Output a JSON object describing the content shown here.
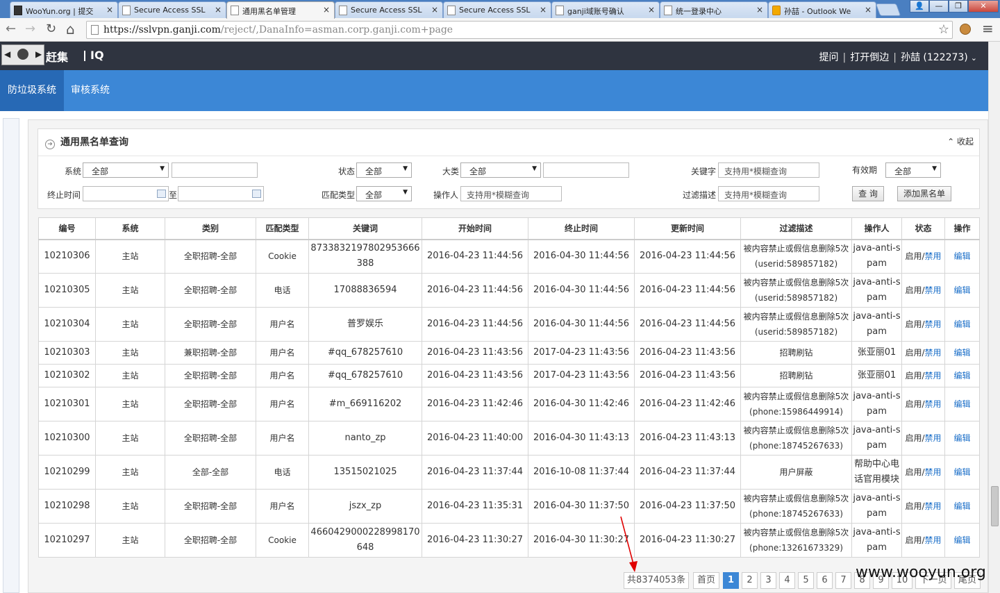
{
  "browser": {
    "tabs": [
      {
        "label": "WooYun.org | 提交",
        "icon": "wooyun-favicon"
      },
      {
        "label": "Secure Access SSL",
        "icon": "page-icon"
      },
      {
        "label": "通用黑名单管理",
        "icon": "page-icon",
        "active": true
      },
      {
        "label": "Secure Access SSL",
        "icon": "page-icon"
      },
      {
        "label": "Secure Access SSL",
        "icon": "page-icon"
      },
      {
        "label": "ganji域账号确认",
        "icon": "page-icon"
      },
      {
        "label": "统一登录中心",
        "icon": "page-icon"
      },
      {
        "label": "孙喆 - Outlook We",
        "icon": "outlook-icon"
      }
    ],
    "tab_close": "×",
    "window_buttons": [
      "👤",
      "—",
      "❐",
      "✕"
    ],
    "url_host": "https://sslvpn.ganji.com",
    "url_path": "/reject/,DanaInfo=asman.corp.ganji.com+page",
    "nav_icons": {
      "back": "←",
      "forward": "→",
      "reload": "↻",
      "home": "⌂",
      "star": "☆",
      "menu": "≡"
    }
  },
  "header": {
    "logo_arrows": [
      "◀",
      "▶"
    ],
    "brand": "赶集",
    "brand_suffix": "IQ",
    "links": [
      "提问",
      "打开倒边",
      "孙喆 (122273)"
    ],
    "caret": "⌄"
  },
  "subnav": [
    "防垃圾系统",
    "审核系统"
  ],
  "filter": {
    "title": "通用黑名单查询",
    "collapse": "收起",
    "fields": {
      "system_label": "系统",
      "system_value": "全部",
      "status_label": "状态",
      "status_value": "全部",
      "category_label": "大类",
      "category_value": "全部",
      "keyword_label": "关键字",
      "keyword_placeholder": "支持用*模糊查询",
      "validity_label": "有效期",
      "validity_value": "全部",
      "endtime_label": "终止时间",
      "to_label": "至",
      "matchtype_label": "匹配类型",
      "matchtype_value": "全部",
      "operator_label": "操作人",
      "operator_placeholder": "支持用*模糊查询",
      "desc_label": "过滤描述",
      "desc_placeholder": "支持用*模糊查询"
    },
    "query_button": "查 询",
    "add_button": "添加黑名单",
    "select_arrow": "▼"
  },
  "table": {
    "headers": [
      "编号",
      "系统",
      "类别",
      "匹配类型",
      "关键词",
      "开始时间",
      "终止时间",
      "更新时间",
      "过滤描述",
      "操作人",
      "状态",
      "操作"
    ],
    "status_on": "启用/",
    "status_ban": "禁用",
    "edit": "编辑",
    "rows": [
      [
        "10210306",
        "主站",
        "全职招聘-全部",
        "Cookie",
        "8733832197802953666388",
        "2016-04-23 11:44:56",
        "2016-04-30 11:44:56",
        "2016-04-23 11:44:56",
        "被内容禁止或假信息删除5次(userid:589857182)",
        "java-anti-spam"
      ],
      [
        "10210305",
        "主站",
        "全职招聘-全部",
        "电话",
        "17088836594",
        "2016-04-23 11:44:56",
        "2016-04-30 11:44:56",
        "2016-04-23 11:44:56",
        "被内容禁止或假信息删除5次(userid:589857182)",
        "java-anti-spam"
      ],
      [
        "10210304",
        "主站",
        "全职招聘-全部",
        "用户名",
        "普罗娱乐",
        "2016-04-23 11:44:56",
        "2016-04-30 11:44:56",
        "2016-04-23 11:44:56",
        "被内容禁止或假信息删除5次(userid:589857182)",
        "java-anti-spam"
      ],
      [
        "10210303",
        "主站",
        "兼职招聘-全部",
        "用户名",
        "#qq_678257610",
        "2016-04-23 11:43:56",
        "2017-04-23 11:43:56",
        "2016-04-23 11:43:56",
        "招聘刷钻",
        "张亚丽01"
      ],
      [
        "10210302",
        "主站",
        "全职招聘-全部",
        "用户名",
        "#qq_678257610",
        "2016-04-23 11:43:56",
        "2017-04-23 11:43:56",
        "2016-04-23 11:43:56",
        "招聘刷钻",
        "张亚丽01"
      ],
      [
        "10210301",
        "主站",
        "全职招聘-全部",
        "用户名",
        "#m_669116202",
        "2016-04-23 11:42:46",
        "2016-04-30 11:42:46",
        "2016-04-23 11:42:46",
        "被内容禁止或假信息删除5次(phone:15986449914)",
        "java-anti-spam"
      ],
      [
        "10210300",
        "主站",
        "全职招聘-全部",
        "用户名",
        "nanto_zp",
        "2016-04-23 11:40:00",
        "2016-04-30 11:43:13",
        "2016-04-23 11:43:13",
        "被内容禁止或假信息删除5次(phone:18745267633)",
        "java-anti-spam"
      ],
      [
        "10210299",
        "主站",
        "全部-全部",
        "电话",
        "13515021025",
        "2016-04-23 11:37:44",
        "2016-10-08 11:37:44",
        "2016-04-23 11:37:44",
        "用户屏蔽",
        "帮助中心电话官用模块"
      ],
      [
        "10210298",
        "主站",
        "全职招聘-全部",
        "用户名",
        "jszx_zp",
        "2016-04-23 11:35:31",
        "2016-04-30 11:37:50",
        "2016-04-23 11:37:50",
        "被内容禁止或假信息删除5次(phone:18745267633)",
        "java-anti-spam"
      ],
      [
        "10210297",
        "主站",
        "全职招聘-全部",
        "Cookie",
        "4660429000228998170648",
        "2016-04-23 11:30:27",
        "2016-04-30 11:30:27",
        "2016-04-23 11:30:27",
        "被内容禁止或假信息删除5次(phone:13261673329)",
        "java-anti-spam"
      ]
    ]
  },
  "pager": {
    "total": "共8374053条",
    "first": "首页",
    "pages": [
      "1",
      "2",
      "3",
      "4",
      "5",
      "6",
      "7",
      "8",
      "9",
      "10"
    ],
    "current": "1",
    "next": "下一页",
    "last": "尾页"
  },
  "annotation_color": "#e00000",
  "watermark": "www.wooyun.org"
}
